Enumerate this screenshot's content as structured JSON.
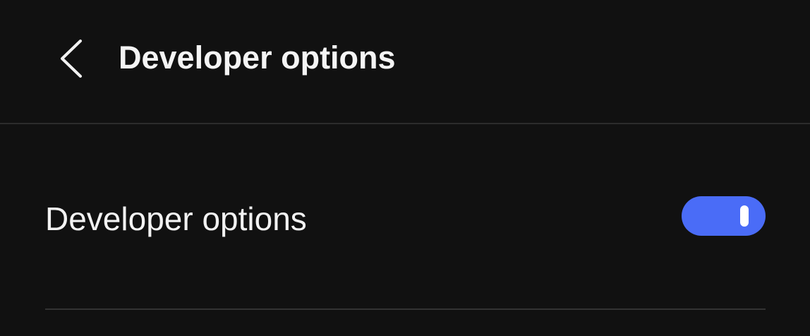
{
  "header": {
    "back_icon": "chevron-left-icon",
    "title": "Developer options"
  },
  "settings": [
    {
      "label": "Developer options",
      "toggle_on": true,
      "toggle_color": "#4a6cf7"
    }
  ],
  "colors": {
    "background": "#111111",
    "text": "#f2f2f2",
    "accent": "#4a6cf7",
    "divider": "#2c2c2c"
  }
}
